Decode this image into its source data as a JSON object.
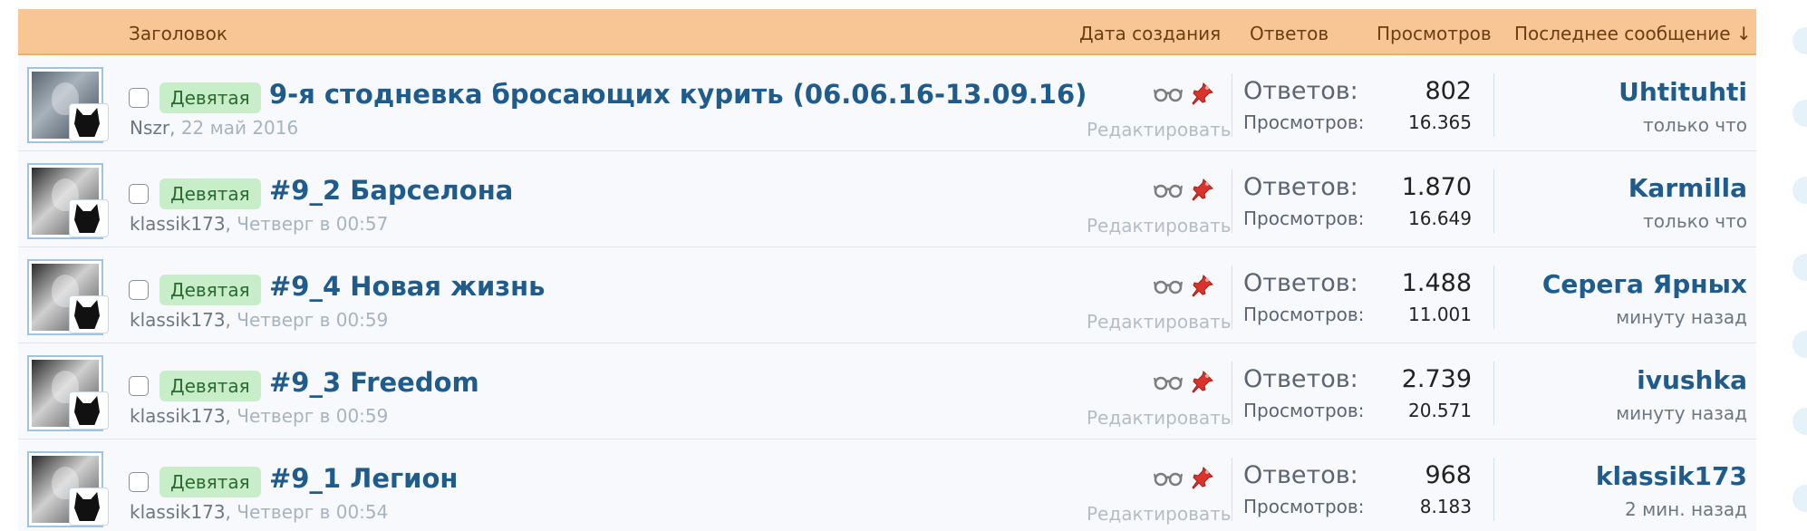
{
  "header": {
    "title": "Заголовок",
    "date": "Дата создания",
    "replies": "Ответов",
    "views": "Просмотров",
    "last_message": "Последнее сообщение ↓"
  },
  "labels": {
    "replies": "Ответов:",
    "views": "Просмотров:",
    "edit": "Редактировать"
  },
  "threads": [
    {
      "prefix": "Девятая",
      "title": "9-я стодневка бросающих курить (06.06.16-13.09.16)",
      "author": "Nszr",
      "date": "22 май 2016",
      "replies": "802",
      "views": "16.365",
      "last_user": "Uhtituhti",
      "last_time": "только что",
      "avatar": "photo"
    },
    {
      "prefix": "Девятая",
      "title": "#9_2 Барселона",
      "author": "klassik173",
      "date": "Четверг в 00:57",
      "replies": "1.870",
      "views": "16.649",
      "last_user": "Karmilla",
      "last_time": "только что",
      "avatar": "bw"
    },
    {
      "prefix": "Девятая",
      "title": "#9_4 Новая жизнь",
      "author": "klassik173",
      "date": "Четверг в 00:59",
      "replies": "1.488",
      "views": "11.001",
      "last_user": "Серега Ярных",
      "last_time": "минуту назад",
      "avatar": "bw"
    },
    {
      "prefix": "Девятая",
      "title": "#9_3 Freedom",
      "author": "klassik173",
      "date": "Четверг в 00:59",
      "replies": "2.739",
      "views": "20.571",
      "last_user": "ivushka",
      "last_time": "минуту назад",
      "avatar": "bw"
    },
    {
      "prefix": "Девятая",
      "title": "#9_1 Легион",
      "author": "klassik173",
      "date": "Четверг в 00:54",
      "replies": "968",
      "views": "8.183",
      "last_user": "klassik173",
      "last_time": "2 мин. назад",
      "avatar": "bw"
    }
  ]
}
